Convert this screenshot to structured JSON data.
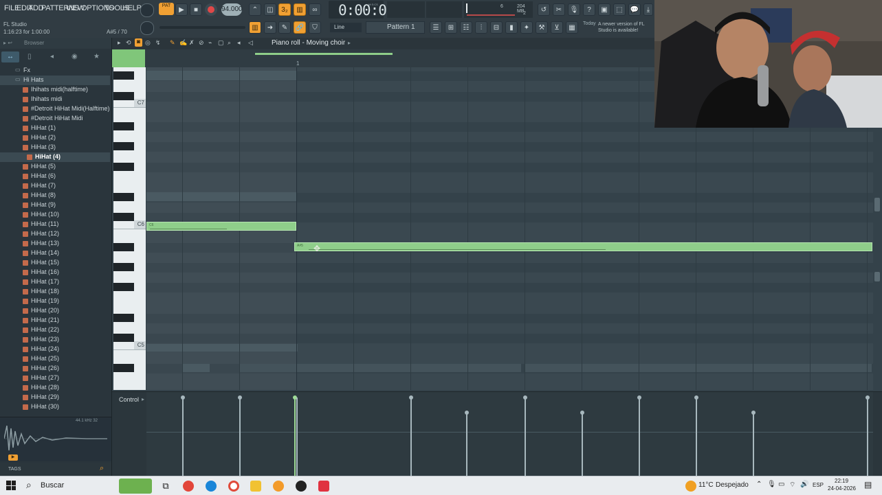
{
  "menu": [
    "FILE",
    "EDIT",
    "ADD",
    "PATTERNS",
    "VIEW",
    "OPTIONS",
    "TOOLS",
    "HELP"
  ],
  "app": {
    "name": "FL Studio",
    "hint": "1:16:23 for 1:00:00",
    "counter": "A#5 / 70"
  },
  "transport": {
    "pat_label": "PAT",
    "tempo": "94.000",
    "time": "0:00:00",
    "time_unit": "M:S:CS",
    "cpu": "6",
    "mem": "204 MB",
    "voices": "2"
  },
  "toolbar": {
    "snap": "Line",
    "pattern": "Pattern 1",
    "news_day": "Today",
    "news_text": "A newer version of FL Studio is available!"
  },
  "browser": {
    "title": "Browser",
    "tree": [
      {
        "label": "Fx",
        "kind": "folder"
      },
      {
        "label": "Hi Hats",
        "kind": "folder-open"
      }
    ],
    "items": [
      "Ihihats midi(halftime)",
      "Ihihats midi",
      "#Detroit HiHat Midi(Halftime)",
      "#Detroit HiHat Midi",
      "HiHat (1)",
      "HiHat (2)",
      "HiHat (3)",
      "HiHat (4)",
      "HiHat (5)",
      "HiHat (6)",
      "HiHat (7)",
      "HiHat (8)",
      "HiHat (9)",
      "HiHat (10)",
      "HiHat (11)",
      "HiHat (12)",
      "HiHat (13)",
      "HiHat (14)",
      "HiHat (15)",
      "HiHat (16)",
      "HiHat (17)",
      "HiHat (18)",
      "HiHat (19)",
      "HiHat (20)",
      "HiHat (21)",
      "HiHat (22)",
      "HiHat (23)",
      "HiHat (24)",
      "HiHat (25)",
      "HiHat (26)",
      "HiHat (27)",
      "HiHat (28)",
      "HiHat (29)",
      "HiHat (30)"
    ],
    "selected_index": 7,
    "waveform_info": "44.1 kHz 32",
    "tags": "TAGS"
  },
  "pianoroll": {
    "title": "Piano roll - Moving choir",
    "ruler_mark": "1",
    "octaves": [
      "C7",
      "C6",
      "C5"
    ],
    "notes": [
      {
        "label": "C6"
      },
      {
        "label": "A#5"
      }
    ],
    "control_label": "Control"
  },
  "taskbar": {
    "search": "Buscar",
    "weather_temp": "11°C",
    "weather_desc": "Despejado",
    "lang": "ESP",
    "time": "22:19",
    "date": "24-04-2026"
  }
}
